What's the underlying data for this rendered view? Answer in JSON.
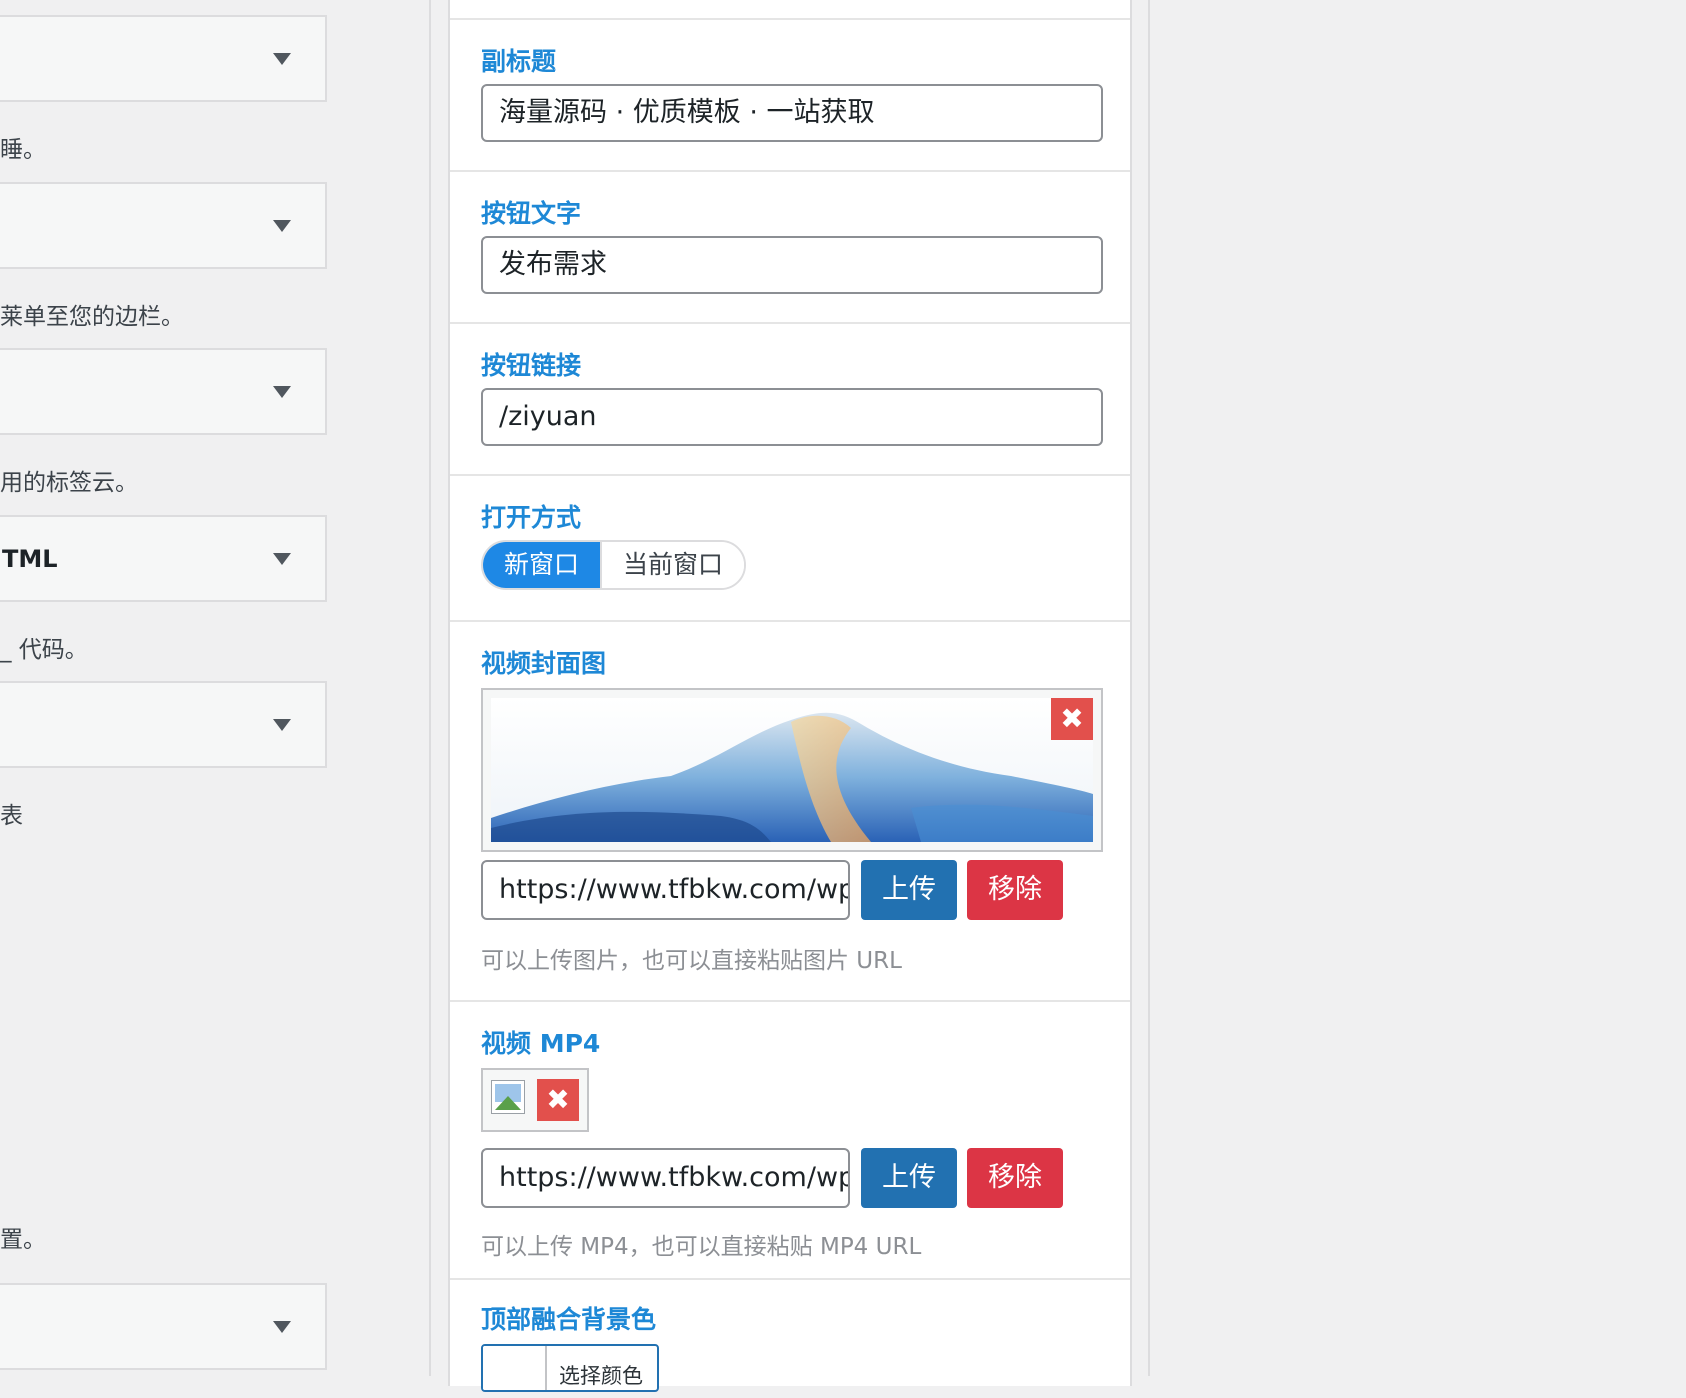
{
  "left_widgets": {
    "boxes": [
      {
        "title": ""
      },
      {
        "title": ""
      },
      {
        "title": ""
      },
      {
        "title": "TML"
      },
      {
        "title": ""
      },
      {
        "title": ""
      }
    ],
    "descriptions": [
      "睡。",
      "莱单至您的边栏。",
      "用的标签云。",
      "_ 代码。",
      "表",
      "置。"
    ]
  },
  "panel": {
    "subtitle": {
      "label": "副标题",
      "value": "海量源码 · 优质模板 · 一站获取"
    },
    "button_text": {
      "label": "按钮文字",
      "value": "发布需求"
    },
    "button_link": {
      "label": "按钮链接",
      "value": "/ziyuan"
    },
    "open_mode": {
      "label": "打开方式",
      "options": [
        "新窗口",
        "当前窗口"
      ],
      "selected": "新窗口"
    },
    "video_cover": {
      "label": "视频封面图",
      "url": "https://www.tfbkw.com/wp",
      "upload_label": "上传",
      "remove_label": "移除",
      "hint": "可以上传图片，也可以直接粘贴图片 URL"
    },
    "video_mp4": {
      "label": "视频 MP4",
      "url": "https://www.tfbkw.com/wp",
      "upload_label": "上传",
      "remove_label": "移除",
      "hint": "可以上传 MP4，也可以直接粘贴 MP4 URL"
    },
    "top_bg_color": {
      "label": "顶部融合背景色",
      "picker_label": "选择颜色"
    }
  },
  "colors": {
    "label_blue": "#1e88d6",
    "upload_button": "#2271b1",
    "remove_button": "#dc3545",
    "remove_icon": "#e2504c",
    "active_segment": "#1e88e5"
  },
  "icons": {
    "remove": "close-icon",
    "dropdown": "triangle-down-icon",
    "broken_image": "broken-image-icon"
  },
  "glyphs": {
    "close": "✖"
  }
}
